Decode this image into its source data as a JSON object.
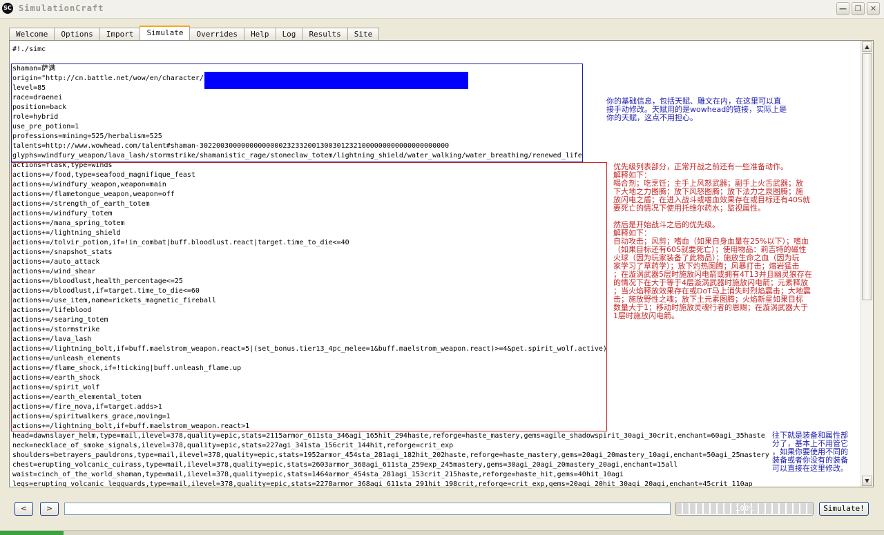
{
  "window": {
    "title": "SimulationCraft",
    "icon_text": "SC",
    "controls": {
      "minimize": "—",
      "maximize": "❐",
      "close": "✕"
    }
  },
  "tabs": [
    {
      "label": "Welcome",
      "active": false
    },
    {
      "label": "Options",
      "active": false
    },
    {
      "label": "Import",
      "active": false
    },
    {
      "label": "Simulate",
      "active": true
    },
    {
      "label": "Overrides",
      "active": false
    },
    {
      "label": "Help",
      "active": false
    },
    {
      "label": "Log",
      "active": false
    },
    {
      "label": "Results",
      "active": false
    },
    {
      "label": "Site",
      "active": false
    }
  ],
  "editor": {
    "lines": [
      "#!./simc",
      "",
      "shaman=萨满",
      "origin=\"http://cn.battle.net/wow/en/character/                                                       \"",
      "level=85",
      "race=draenei",
      "position=back",
      "role=hybrid",
      "use_pre_potion=1",
      "professions=mining=525/herbalism=525",
      "talents=http://www.wowhead.com/talent#shaman-302200300000000000002323320013003012321000000000000000000000",
      "glyphs=windfury_weapon/lava_lash/stormstrike/shamanistic_rage/stoneclaw_totem/lightning_shield/water_walking/water_breathing/renewed_life",
      "actions=flask,type=winds",
      "actions+=/food,type=seafood_magnifique_feast",
      "actions+=/windfury_weapon,weapon=main",
      "actions+=/flametongue_weapon,weapon=off",
      "actions+=/strength_of_earth_totem",
      "actions+=/windfury_totem",
      "actions+=/mana_spring_totem",
      "actions+=/lightning_shield",
      "actions+=/tolvir_potion,if=!in_combat|buff.bloodlust.react|target.time_to_die<=40",
      "actions+=/snapshot_stats",
      "actions+=/auto_attack",
      "actions+=/wind_shear",
      "actions+=/bloodlust,health_percentage<=25",
      "actions+=/bloodlust,if=target.time_to_die<=60",
      "actions+=/use_item,name=rickets_magnetic_fireball",
      "actions+=/lifeblood",
      "actions+=/searing_totem",
      "actions+=/stormstrike",
      "actions+=/lava_lash",
      "actions+=/lightning_bolt,if=buff.maelstrom_weapon.react=5|(set_bonus.tier13_4pc_melee=1&buff.maelstrom_weapon.react)>=4&pet.spirit_wolf.active)",
      "actions+=/unleash_elements",
      "actions+=/flame_shock,if=!ticking|buff.unleash_flame.up",
      "actions+=/earth_shock",
      "actions+=/spirit_wolf",
      "actions+=/earth_elemental_totem",
      "actions+=/fire_nova,if=target.adds>1",
      "actions+=/spiritwalkers_grace,moving=1",
      "actions+=/lightning_bolt,if=buff.maelstrom_weapon.react>1",
      "head=dawnslayer_helm,type=mail,ilevel=378,quality=epic,stats=2115armor_611sta_346agi_165hit_294haste,reforge=haste_mastery,gems=agile_shadowspirit_30agi_30crit,enchant=60agi_35haste",
      "neck=necklace_of_smoke_signals,ilevel=378,quality=epic,stats=227agi_341sta_156crit_144hit,reforge=crit_exp",
      "shoulders=betrayers_pauldrons,type=mail,ilevel=378,quality=epic,stats=1952armor_454sta_281agi_182hit_202haste,reforge=haste_mastery,gems=20agi_20mastery_10agi,enchant=50agi_25mastery",
      "chest=erupting_volcanic_cuirass,type=mail,ilevel=378,quality=epic,stats=2603armor_368agi_611sta_259exp_245mastery,gems=30agi_20agi_20mastery_20agi,enchant=15all",
      "waist=cinch_of_the_world_shaman,type=mail,ilevel=378,quality=epic,stats=1464armor_454sta_281agi_153crit_215haste,reforge=haste_hit,gems=40hit_10agi",
      "legs=erupting_volcanic_legguards,type=mail,ilevel=378,quality=epic,stats=2278armor_368agi_611sta_291hit_198crit,reforge=crit_exp,gems=20agi_20hit_30agi_20agi,enchant=45crit_110ap"
    ]
  },
  "annotations": {
    "basic_info": "你的基础信息，包括天赋、雕文在内，在这里可以直\n接手动修改。天赋用的是wowhead的链接，实际上是\n你的天赋，这点不用担心。",
    "actions": "优先级列表部分，正常开战之前还有一些准备动作。\n解释如下：\n喝合剂；吃烹饪；主手上风怒武器；副手上火舌武器；放\n下大地之力图腾；放下风怒图腾；放下法力之泉图腾；施\n放闪电之盾；在进入战斗或嗜血效果存在或目标还有40S就\n要死亡的情况下使用托维尔药水；监视属性。\n\n然后是开始战斗之后的优先级。\n解释如下：\n自动攻击；风剪；嗜血（如果自身血量在25%以下）；嗜血\n（如果目标还有60S就要死亡）；使用物品：莉吉特的磁性\n火球（因为玩家装备了此物品）；施放生命之血（因为玩\n家学习了草药学）；放下灼热图腾；风暴打击；熔岩猛击\n；在漩涡武器5层时施放闪电箭或拥有4T13并且幽灵狼存在\n的情况下在大于等于4层漩涡武器时施放闪电箭；元素释放\n；当火焰释放效果存在或DoT马上消失时烈焰震击；大地震\n击；施放野性之魂；放下土元素图腾；火焰新星如果目标\n数量大于1；移动时施放灵魂行者的恩赐；在漩涡武器大于\n1层时施放闪电箭。",
    "gear": "往下就是装备和属性部\n分了，基本上不用管它\n，如果你要使用不同的\n装备或者你没有的装备\n可以直接在这里修改。",
    "colors": {
      "blue": "#1f1fb0",
      "red": "#c62828",
      "redaction": "#0000ff"
    }
  },
  "bottom": {
    "back_label": "<",
    "forward_label": ">",
    "command_value": "",
    "progress_text": "100%",
    "progress_value": 1.0,
    "simulate_label": "Simulate!"
  }
}
